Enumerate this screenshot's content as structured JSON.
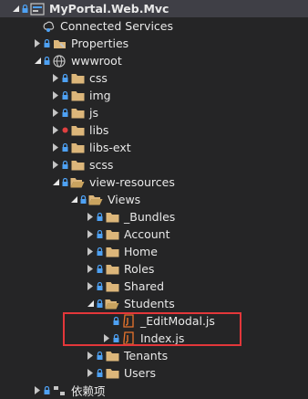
{
  "tree": {
    "project": "MyPortal.Web.Mvc",
    "connected_services": "Connected Services",
    "properties": "Properties",
    "wwwroot": "wwwroot",
    "css": "css",
    "img": "img",
    "js": "js",
    "libs": "libs",
    "libs_ext": "libs-ext",
    "scss": "scss",
    "view_resources": "view-resources",
    "views": "Views",
    "bundles": "_Bundles",
    "account": "Account",
    "home": "Home",
    "roles": "Roles",
    "shared": "Shared",
    "students": "Students",
    "edit_modal": "_EditModal.js",
    "index": "Index.js",
    "tenants": "Tenants",
    "users": "Users",
    "cut_off": "依赖项"
  },
  "colors": {
    "background": "#252526",
    "selected_row": "#3f3f46",
    "folder": "#dcb67a",
    "lock": "#4ea1f3",
    "js_file": "#e8732c",
    "red_dot": "#e04040",
    "highlight": "#e3373a"
  }
}
